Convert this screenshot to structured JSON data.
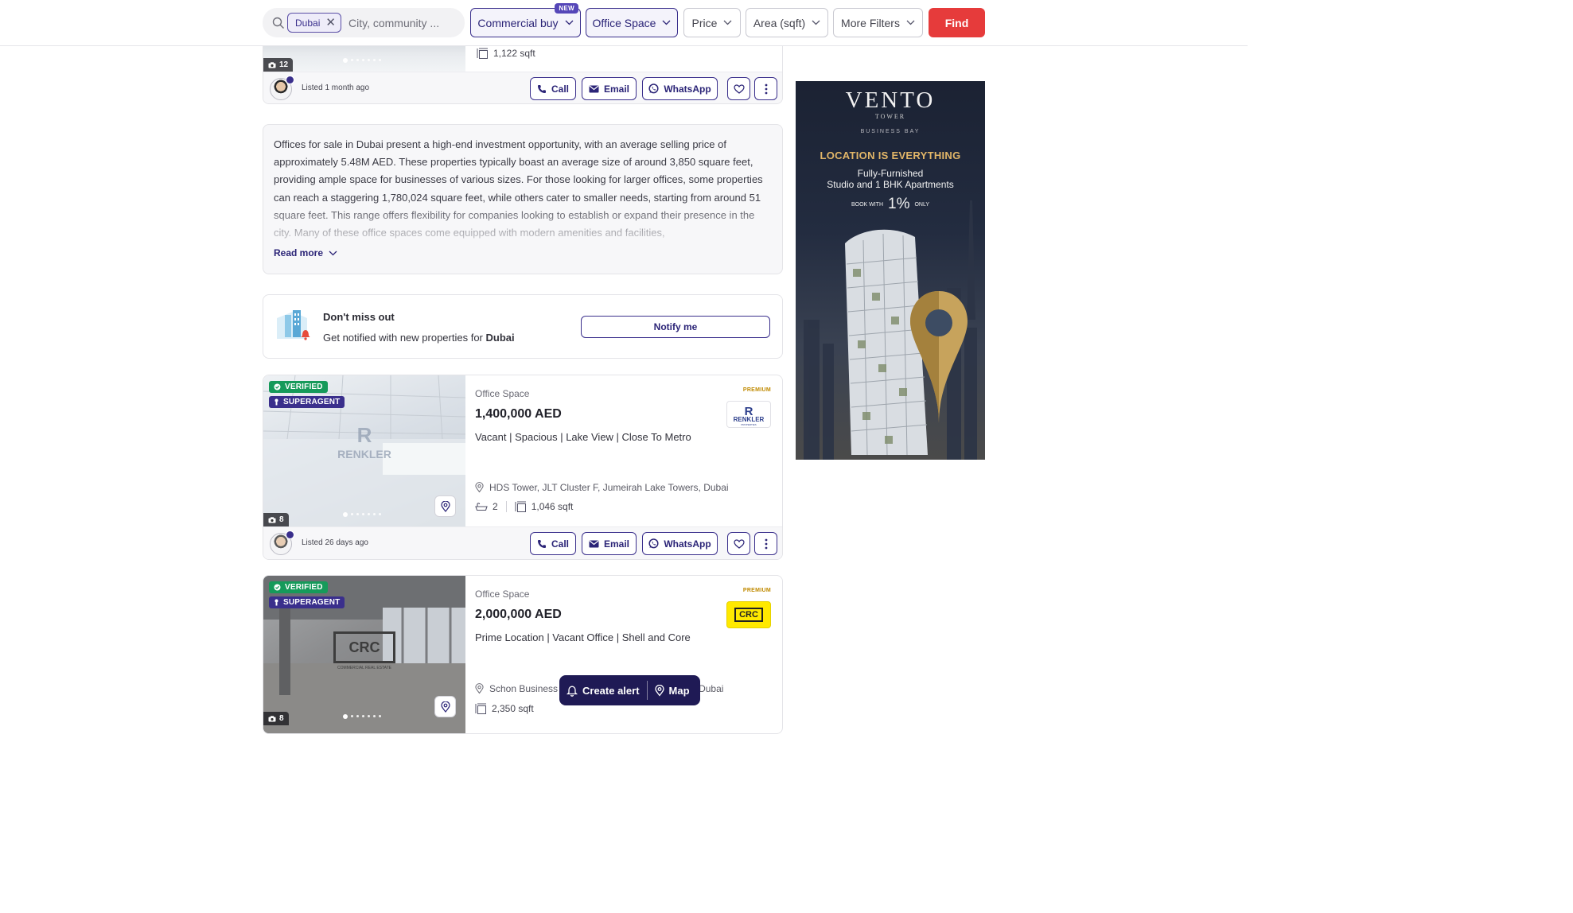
{
  "search": {
    "chip_label": "Dubai",
    "placeholder": "City, community ...",
    "filters": {
      "category": "Commercial buy",
      "category_badge": "NEW",
      "property_type": "Office Space",
      "price": "Price",
      "area": "Area (sqft)",
      "more": "More Filters"
    },
    "find_label": "Find"
  },
  "listing_top": {
    "photo_count": "12",
    "area": "1,122 sqft",
    "listed": "Listed 1 month ago"
  },
  "actions": {
    "call": "Call",
    "email": "Email",
    "whatsapp": "WhatsApp"
  },
  "description": {
    "text": "Offices for sale in Dubai present a high-end investment opportunity, with an average selling price of approximately 5.48M AED. These properties typically boast an average size of around 3,850 square feet, providing ample space for businesses of various sizes. For those looking for larger offices, some properties can reach a staggering 1,780,024 square feet, while others cater to smaller needs, starting from around 51 square feet. This range offers flexibility for companies looking to establish or expand their presence in the city. Many of these office spaces come equipped with modern amenities and facilities,",
    "read_more": "Read more"
  },
  "notify": {
    "heading": "Don't miss out",
    "sub_prefix": "Get notified with new properties for",
    "sub_location": "Dubai",
    "button": "Notify me"
  },
  "listings": [
    {
      "badges": {
        "verified": "VERIFIED",
        "super": "SUPERAGENT"
      },
      "photo_count": "8",
      "type": "Office Space",
      "price": "1,400,000 AED",
      "title": "Vacant | Spacious | Lake View | Close To Metro",
      "premium": "PREMIUM",
      "logo_text": "RENKLER",
      "logo_sub": "PROPERTIES",
      "address": "HDS Tower, JLT Cluster F, Jumeirah Lake Towers, Dubai",
      "baths": "2",
      "area": "1,046 sqft",
      "listed": "Listed 26 days ago"
    },
    {
      "badges": {
        "verified": "VERIFIED",
        "super": "SUPERAGENT"
      },
      "photo_count": "8",
      "type": "Office Space",
      "price": "2,000,000 AED",
      "title": "Prime Location | Vacant Office | Shell and Core",
      "premium": "PREMIUM",
      "logo_text": "CRC",
      "address_start": "Schon Business",
      "address_end": "Dubai",
      "area": "2,350 sqft",
      "watermark": "CRC",
      "watermark_sub": "COMMERCIAL REAL ESTATE"
    }
  ],
  "ad": {
    "brand": "VENTO",
    "brand_sub": "TOWER",
    "district": "BUSINESS BAY",
    "headline": "LOCATION IS EVERYTHING",
    "line1": "Fully-Furnished",
    "line2": "Studio and 1 BHK Apartments",
    "book_prefix": "BOOK WITH",
    "book_value": "1%",
    "book_suffix": "ONLY"
  },
  "floating": {
    "alert": "Create alert",
    "map": "Map"
  },
  "colors": {
    "accent": "#3a2f8c",
    "find": "#e63b3b",
    "verified": "#169a5a",
    "premium": "#c08a00"
  }
}
